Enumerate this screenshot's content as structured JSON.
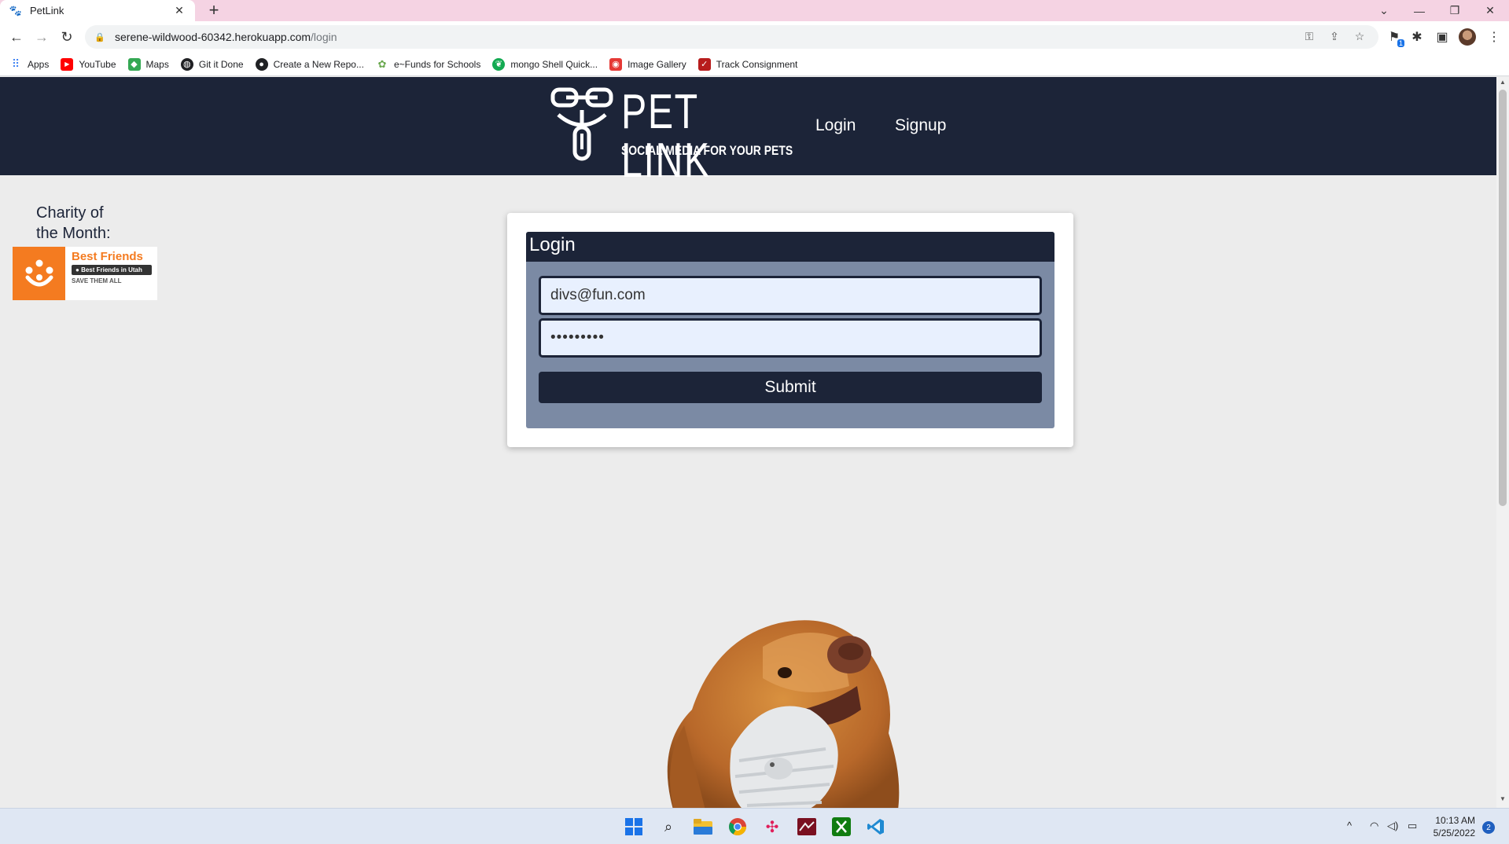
{
  "browser": {
    "tab_title": "PetLink",
    "tab_close": "✕",
    "new_tab": "+",
    "url_host": "serene-wildwood-60342.herokuapp.com",
    "url_path": "/login",
    "extension_badge": "1",
    "bookmarks": [
      {
        "label": "Apps",
        "icon": "apps-grid-icon",
        "color": "#4285f4"
      },
      {
        "label": "YouTube",
        "icon": "youtube-icon",
        "color": "#ff0000"
      },
      {
        "label": "Maps",
        "icon": "maps-icon",
        "color": "#34a853"
      },
      {
        "label": "Git it Done",
        "icon": "globe-icon",
        "color": "#202124"
      },
      {
        "label": "Create a New Repo...",
        "icon": "github-icon",
        "color": "#202124"
      },
      {
        "label": "e~Funds for Schools",
        "icon": "efunds-icon",
        "color": "#6aa84f"
      },
      {
        "label": "mongo Shell Quick...",
        "icon": "mongodb-icon",
        "color": "#13aa52"
      },
      {
        "label": "Image Gallery",
        "icon": "gallery-icon",
        "color": "#e53935"
      },
      {
        "label": "Track Consignment",
        "icon": "tracking-icon",
        "color": "#b71c1c"
      }
    ]
  },
  "site": {
    "logo_title": "PET LINK",
    "logo_tagline": "SOCIAL MEDIA FOR YOUR PETS",
    "nav": {
      "login": "Login",
      "signup": "Signup"
    },
    "charity": {
      "line1": "Charity of",
      "line2": "the Month:",
      "badge_name": "Best Friends",
      "badge_sub": "Best Friends in Utah",
      "badge_slogan": "SAVE THEM ALL"
    },
    "login_form": {
      "heading": "Login",
      "email_value": "divs@fun.com",
      "password_value": "•••••••••",
      "submit_label": "Submit"
    },
    "colors": {
      "navy": "#1c2438",
      "panel": "#7b8aa4",
      "input_bg": "#e8f0fe",
      "charity_orange": "#f47b20"
    }
  },
  "taskbar": {
    "time": "10:13 AM",
    "date": "5/25/2022",
    "notification_count": "2",
    "apps": [
      "start-icon",
      "search-icon",
      "file-explorer-icon",
      "chrome-icon",
      "slack-icon",
      "app-icon",
      "xbox-icon",
      "vscode-icon"
    ]
  }
}
